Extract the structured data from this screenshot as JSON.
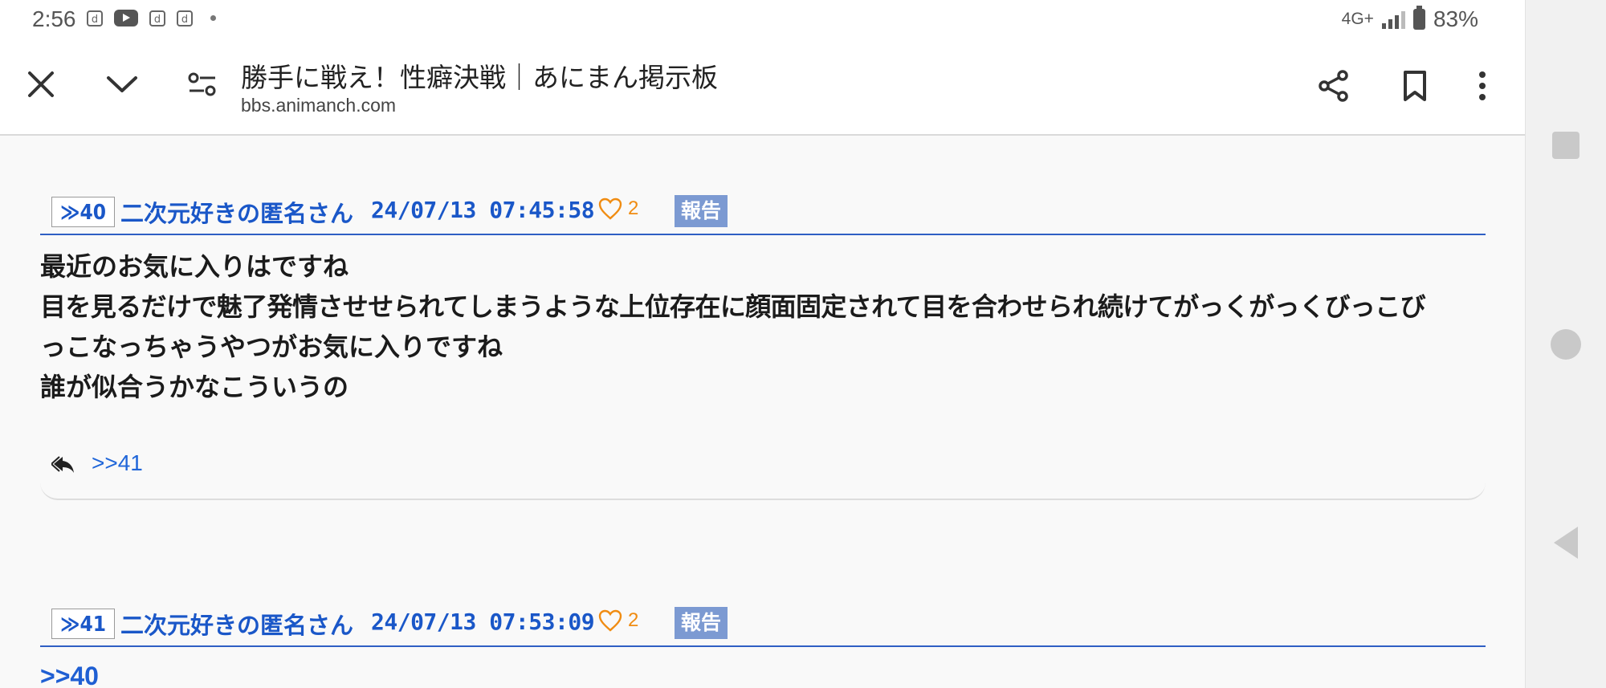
{
  "status_bar": {
    "time": "2:56",
    "notification_icons": [
      "d",
      "youtube",
      "d",
      "d"
    ],
    "network": "4G+",
    "battery": "83%"
  },
  "toolbar": {
    "close_icon": "close-icon",
    "collapse_icon": "chevron-down-icon",
    "site_settings_icon": "tune-icon",
    "title": "勝手に戦え！性癖決戦｜あにまん掲示板",
    "url": "bbs.animanch.com",
    "share_icon": "share-icon",
    "bookmark_icon": "bookmark-icon",
    "menu_icon": "more-vert-icon"
  },
  "posts": [
    {
      "res_number": "≫40",
      "poster": "二次元好きの匿名さん",
      "date": "24/07/13 07:45:58",
      "likes": "2",
      "report_label": "報告",
      "body_lines": [
        "最近のお気に入りはですね",
        "目を見るだけで魅了発情させせられてしまうような上位存在に顔面固定されて目を合わせられ続けてがっくがっくびっこび",
        "っこなっちゃうやつがお気に入りですね",
        "誰が似合うかなこういうの"
      ],
      "reply_link": ">>41"
    },
    {
      "res_number": "≫41",
      "poster": "二次元好きの匿名さん",
      "date": "24/07/13 07:53:09",
      "likes": "2",
      "report_label": "報告",
      "anchor": ">>40"
    }
  ],
  "colors": {
    "link_blue": "#1a57c8",
    "like_orange": "#f08c12",
    "report_bg": "#7c9ad2"
  }
}
